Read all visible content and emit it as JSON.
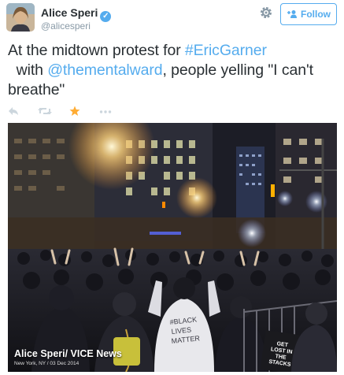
{
  "author": {
    "name": "Alice Speri",
    "handle": "@alicesperi",
    "verified": true
  },
  "follow_button": {
    "label": "Follow"
  },
  "tweet": {
    "text_before": "At the midtown protest for ",
    "hashtag": "#EricGarner",
    "text_middle": "  with ",
    "mention": "@thementalward",
    "text_after": ", people yelling \"I can't breathe\""
  },
  "actions": [
    "reply-icon",
    "retweet-icon",
    "favorite-icon",
    "more-icon"
  ],
  "media": {
    "credit": "Alice Speri/ VICE News",
    "credit_sub": "New York, NY / 03 Dec 2014",
    "sign_text": "GET LOST IN THE STACKS"
  },
  "colors": {
    "link": "#55acee",
    "text": "#292f33",
    "muted": "#8899a6",
    "favorite": "#ffac33"
  }
}
